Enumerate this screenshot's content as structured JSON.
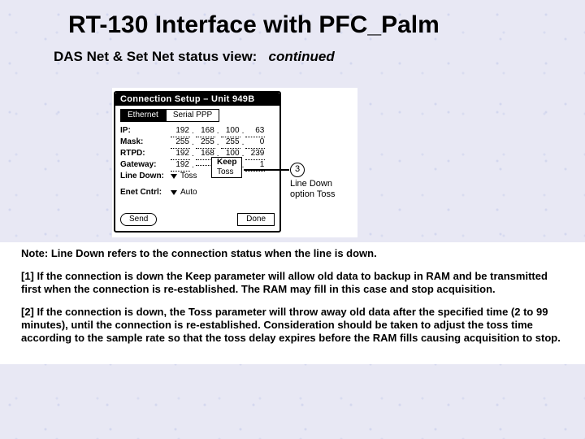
{
  "title": "RT-130 Interface with PFC_Palm",
  "subtitle_main": "DAS Net & Set Net status view:",
  "subtitle_cont": "continued",
  "palm": {
    "titlebar": "Connection Setup – Unit 949B",
    "tabs": {
      "ethernet": "Ethernet",
      "serial": "Serial PPP"
    },
    "labels": {
      "ip": "IP:",
      "mask": "Mask:",
      "rtpd": "RTPD:",
      "gateway": "Gateway:",
      "linedown": "Line Down:",
      "enetcntrl": "Enet Cntrl:"
    },
    "ip": [
      "192",
      "168",
      "100",
      "63"
    ],
    "mask": [
      "255",
      "255",
      "255",
      "0"
    ],
    "rtpd": [
      "192",
      "168",
      "100",
      "239"
    ],
    "gateway": [
      "192",
      "",
      "",
      "1"
    ],
    "linedown_value": "Toss",
    "linedown_options": {
      "keep": "Keep",
      "toss": "Toss"
    },
    "enet_value": "Auto",
    "buttons": {
      "send": "Send",
      "done": "Done"
    }
  },
  "callout": {
    "number": "3",
    "line1": "Line Down",
    "line2": "option Toss"
  },
  "notes": {
    "n0": "Note: Line Down refers to the connection status when the line is down.",
    "n1": "[1] If the connection is down the Keep parameter will allow old data to backup in RAM and be transmitted first when the connection is re-established. The RAM may fill in this case and stop acquisition.",
    "n2": "[2] If the connection is down, the Toss parameter will throw away old data after the specified time (2 to 99 minutes), until the connection is re-established. Consideration should be taken to adjust the toss time according to the sample rate so that the toss delay expires before the RAM fills causing acquisition to stop."
  }
}
